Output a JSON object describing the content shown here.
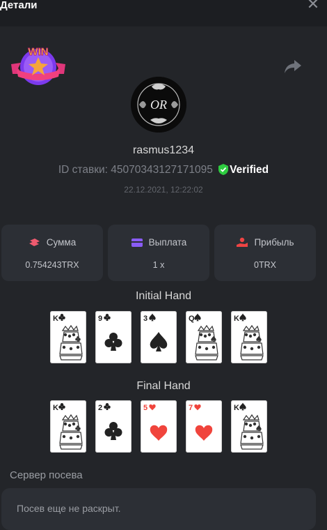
{
  "header": {
    "title": "Детали",
    "close_label": "✕"
  },
  "badge": {
    "text": "WIN"
  },
  "user": {
    "name": "rasmus1234",
    "avatar_text": "OR"
  },
  "bet": {
    "id_label": "ID ставки:",
    "id_value": "45070343127171095",
    "verified_label": "Verified",
    "datetime": "22.12.2021, 12:22:02"
  },
  "stats": [
    {
      "label": "Сумма",
      "value": "0.754243TRX",
      "icon": "coins-icon"
    },
    {
      "label": "Выплата",
      "value": "1 x",
      "icon": "wallet-icon"
    },
    {
      "label": "Прибыль",
      "value": "0TRX",
      "icon": "profit-icon"
    }
  ],
  "initial_hand": {
    "title": "Initial Hand",
    "cards": [
      {
        "rank": "K",
        "suit": "clubs",
        "color": "#222222"
      },
      {
        "rank": "9",
        "suit": "clubs",
        "color": "#222222"
      },
      {
        "rank": "3",
        "suit": "spades",
        "color": "#222222"
      },
      {
        "rank": "Q",
        "suit": "spades",
        "color": "#222222"
      },
      {
        "rank": "K",
        "suit": "spades",
        "color": "#222222"
      }
    ]
  },
  "final_hand": {
    "title": "Final Hand",
    "cards": [
      {
        "rank": "K",
        "suit": "clubs",
        "color": "#222222"
      },
      {
        "rank": "2",
        "suit": "clubs",
        "color": "#222222"
      },
      {
        "rank": "5",
        "suit": "hearts",
        "color": "#f0443c"
      },
      {
        "rank": "7",
        "suit": "hearts",
        "color": "#f0443c"
      },
      {
        "rank": "K",
        "suit": "spades",
        "color": "#222222"
      }
    ]
  },
  "seed": {
    "label": "Сервер посева",
    "value": "Посев еще не раскрыт."
  },
  "colors": {
    "verified_green": "#2ecc40",
    "coins": "#ef5a6f",
    "wallet": "#8a5cf6",
    "profit": "#ef4444"
  }
}
